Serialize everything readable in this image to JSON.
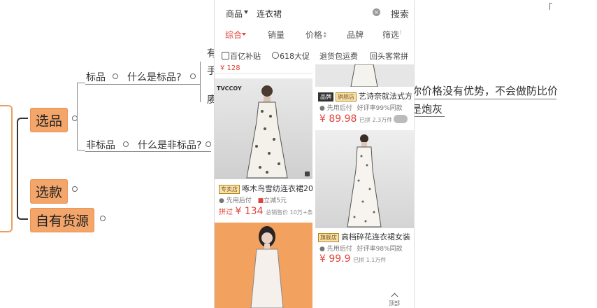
{
  "mindmap": {
    "topic_select_product": "选品",
    "topic_select_style": "选款",
    "topic_own_source": "自有货源",
    "branch_standard": "标品",
    "question_standard": "什么是标品?",
    "branch_nonstandard": "非标品",
    "question_nonstandard": "什么是非标品?",
    "note_line1": "你价格没有优势，不会做防比价",
    "note_line2": "是炮灰",
    "partial_top": "有",
    "partial_mid": "手",
    "partial_low": "赓"
  },
  "phone": {
    "search": {
      "category": "商品",
      "query": "连衣裙",
      "button": "搜索"
    },
    "tabs": [
      "综合",
      "销量",
      "价格",
      "品牌",
      "筛选"
    ],
    "promos": [
      "百亿补贴",
      "618大促",
      "退货包运费",
      "回头客常拼"
    ],
    "top_price": "¥ 128",
    "cards": {
      "left1": {
        "brand_mark": "TVCCOY",
        "tag": "专卖店",
        "title": "啄木鸟雪纺连衣裙20",
        "line1": "先用后付",
        "line2": "立减5元",
        "price_prefix": "拼过",
        "price": "¥ 134",
        "sold": "总销售价 10万+条"
      },
      "right1": {
        "tags": [
          "品牌",
          "旗舰店"
        ],
        "title": "艺诗奈就法式方",
        "line1": "先用后付",
        "line2": "好评率99%同款",
        "price": "¥ 89.98",
        "sold": "已拼 2.3万件"
      },
      "right2": {
        "tag": "旗舰店",
        "title": "高档碎花连衣裙女装",
        "line1": "先用后付",
        "line2": "好评率98%同款",
        "price": "¥ 99.9",
        "sold": "已拼 1.1万件"
      }
    },
    "back_top": "顶部"
  }
}
